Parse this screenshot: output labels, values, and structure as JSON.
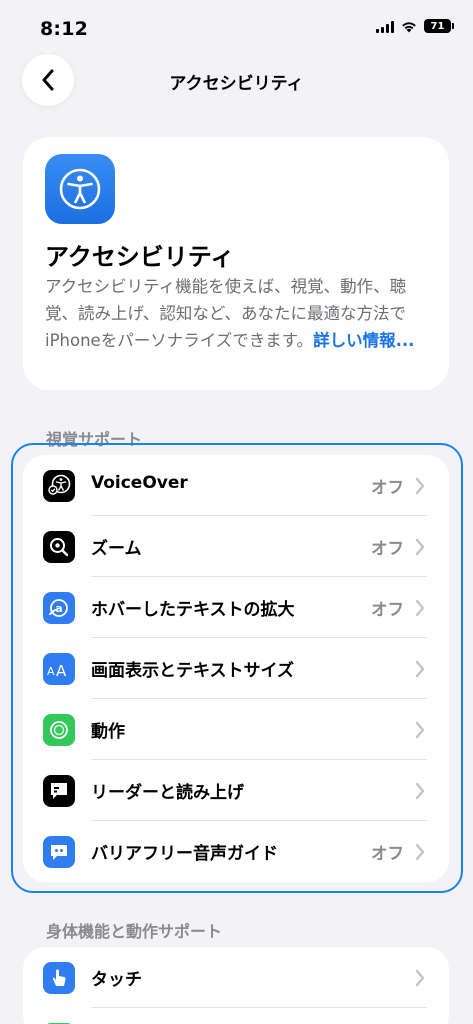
{
  "status": {
    "time": "8:12",
    "battery": "71"
  },
  "nav": {
    "title": "アクセシビリティ"
  },
  "header": {
    "title": "アクセシビリティ",
    "description": "アクセシビリティ機能を使えば、視覚、動作、聴覚、読み上げ、認知など、あなたに最適な方法でiPhoneをパーソナライズできます。",
    "link": "詳しい情報..."
  },
  "sections": {
    "vision": {
      "label": "視覚サポート",
      "items": [
        {
          "label": "VoiceOver",
          "value": "オフ",
          "icon": "voiceover-icon"
        },
        {
          "label": "ズーム",
          "value": "オフ",
          "icon": "zoom-icon"
        },
        {
          "label": "ホバーしたテキストの拡大",
          "value": "オフ",
          "icon": "hover-text-icon"
        },
        {
          "label": "画面表示とテキストサイズ",
          "value": "",
          "icon": "text-size-icon"
        },
        {
          "label": "動作",
          "value": "",
          "icon": "motion-icon"
        },
        {
          "label": "リーダーと読み上げ",
          "value": "",
          "icon": "spoken-content-icon"
        },
        {
          "label": "バリアフリー音声ガイド",
          "value": "オフ",
          "icon": "audio-descriptions-icon"
        }
      ]
    },
    "physical": {
      "label": "身体機能と動作サポート",
      "items": [
        {
          "label": "タッチ",
          "value": "",
          "icon": "touch-icon"
        }
      ]
    }
  },
  "colors": {
    "background": "#f2f2f7",
    "accent": "#1c74e3",
    "focus": "#1a82f0"
  }
}
